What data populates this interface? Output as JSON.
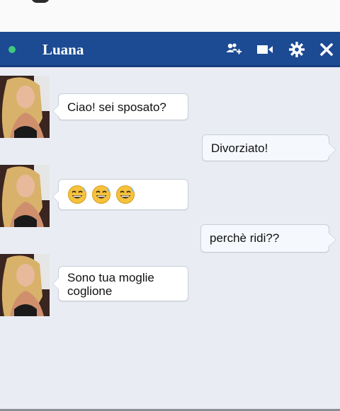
{
  "chat": {
    "contact_name": "Luana",
    "status": "online",
    "colors": {
      "header": "#1c4a93",
      "status_dot": "#3fc97d",
      "background": "#e9edf3"
    },
    "header_icons": [
      "add-friend-icon",
      "video-call-icon",
      "gear-icon",
      "close-icon"
    ]
  },
  "messages": [
    {
      "sender": "Luana",
      "text": "Ciao! sei sposato?"
    },
    {
      "sender": "me",
      "text": "Divorziato!"
    },
    {
      "sender": "Luana",
      "emoji": [
        "grinning-sweat-emoji",
        "grinning-sweat-emoji",
        "grinning-sweat-emoji"
      ]
    },
    {
      "sender": "me",
      "text": "perchè ridi??"
    },
    {
      "sender": "Luana",
      "text_line1": "Sono tua moglie",
      "text_line2": "coglione"
    }
  ]
}
